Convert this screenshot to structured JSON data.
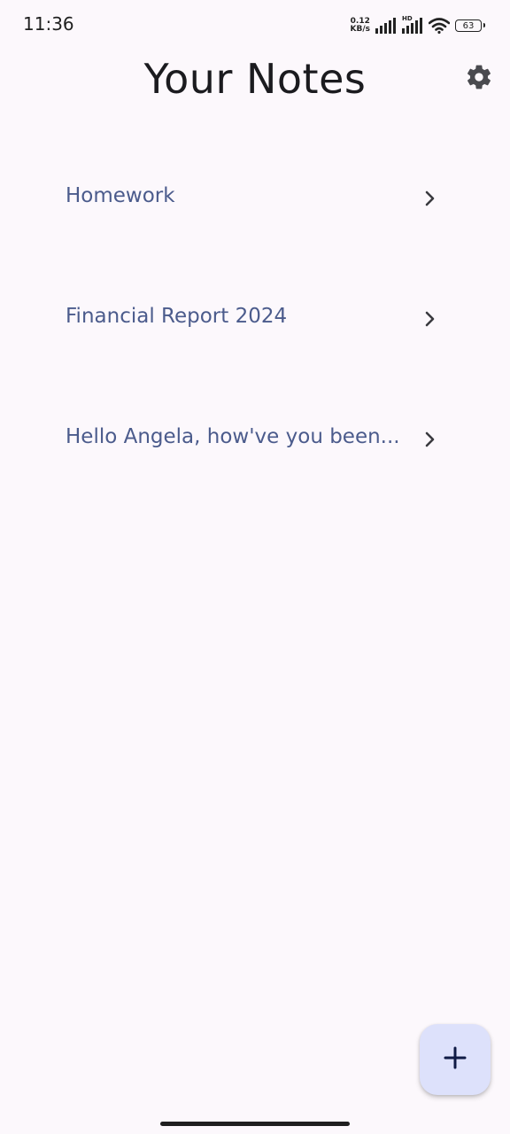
{
  "status_bar": {
    "time": "11:36",
    "net_speed_value": "0.12",
    "net_speed_unit": "KB/s",
    "hd_label": "HD",
    "battery": "63"
  },
  "header": {
    "title": "Your Notes",
    "settings_icon": "gear-icon"
  },
  "notes": [
    {
      "title": "Homework",
      "icon": "chevron-right-icon"
    },
    {
      "title": "Financial Report 2024",
      "icon": "chevron-right-icon"
    },
    {
      "title": "Hello Angela, how've you been...",
      "icon": "chevron-right-icon"
    }
  ],
  "fab": {
    "icon": "plus-icon"
  },
  "colors": {
    "background": "#fcf8fc",
    "note_text": "#4b5b8c",
    "fab_background": "#dde1fb",
    "fab_icon": "#0f1a45"
  }
}
